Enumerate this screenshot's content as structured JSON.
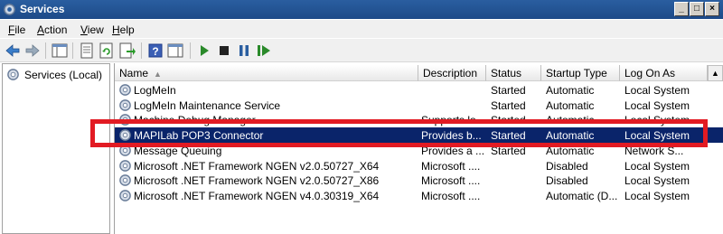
{
  "window": {
    "title": "Services"
  },
  "menu": [
    {
      "label": "File",
      "key": "F",
      "rest": "ile"
    },
    {
      "label": "Action",
      "key": "A",
      "rest": "ction"
    },
    {
      "label": "View",
      "key": "V",
      "rest": "iew"
    },
    {
      "label": "Help",
      "key": "H",
      "rest": "elp"
    }
  ],
  "tree": {
    "root_label": "Services (Local)"
  },
  "columns": {
    "name": "Name",
    "description": "Description",
    "status": "Status",
    "startup_type": "Startup Type",
    "log_on_as": "Log On As"
  },
  "rows": [
    {
      "name": "LogMeIn",
      "description": "",
      "status": "Started",
      "startup": "Automatic",
      "logon": "Local System"
    },
    {
      "name": "LogMeIn Maintenance Service",
      "description": "",
      "status": "Started",
      "startup": "Automatic",
      "logon": "Local System"
    },
    {
      "name": "Machine Debug Manager",
      "description": "Supports lo...",
      "status": "Started",
      "startup": "Automatic",
      "logon": "Local System"
    },
    {
      "name": "MAPILab POP3 Connector",
      "description": "Provides b...",
      "status": "Started",
      "startup": "Automatic",
      "logon": "Local System",
      "selected": true
    },
    {
      "name": "Message Queuing",
      "description": "Provides a ...",
      "status": "Started",
      "startup": "Automatic",
      "logon": "Network S..."
    },
    {
      "name": "Microsoft .NET Framework NGEN v2.0.50727_X64",
      "description": "Microsoft ....",
      "status": "",
      "startup": "Disabled",
      "logon": "Local System"
    },
    {
      "name": "Microsoft .NET Framework NGEN v2.0.50727_X86",
      "description": "Microsoft ....",
      "status": "",
      "startup": "Disabled",
      "logon": "Local System"
    },
    {
      "name": "Microsoft .NET Framework NGEN v4.0.30319_X64",
      "description": "Microsoft ....",
      "status": "",
      "startup": "Automatic (D...",
      "logon": "Local System"
    }
  ],
  "colors": {
    "selection": "#0a246a",
    "highlight_box": "#e21b23",
    "titlebar": "#1d4a88"
  }
}
